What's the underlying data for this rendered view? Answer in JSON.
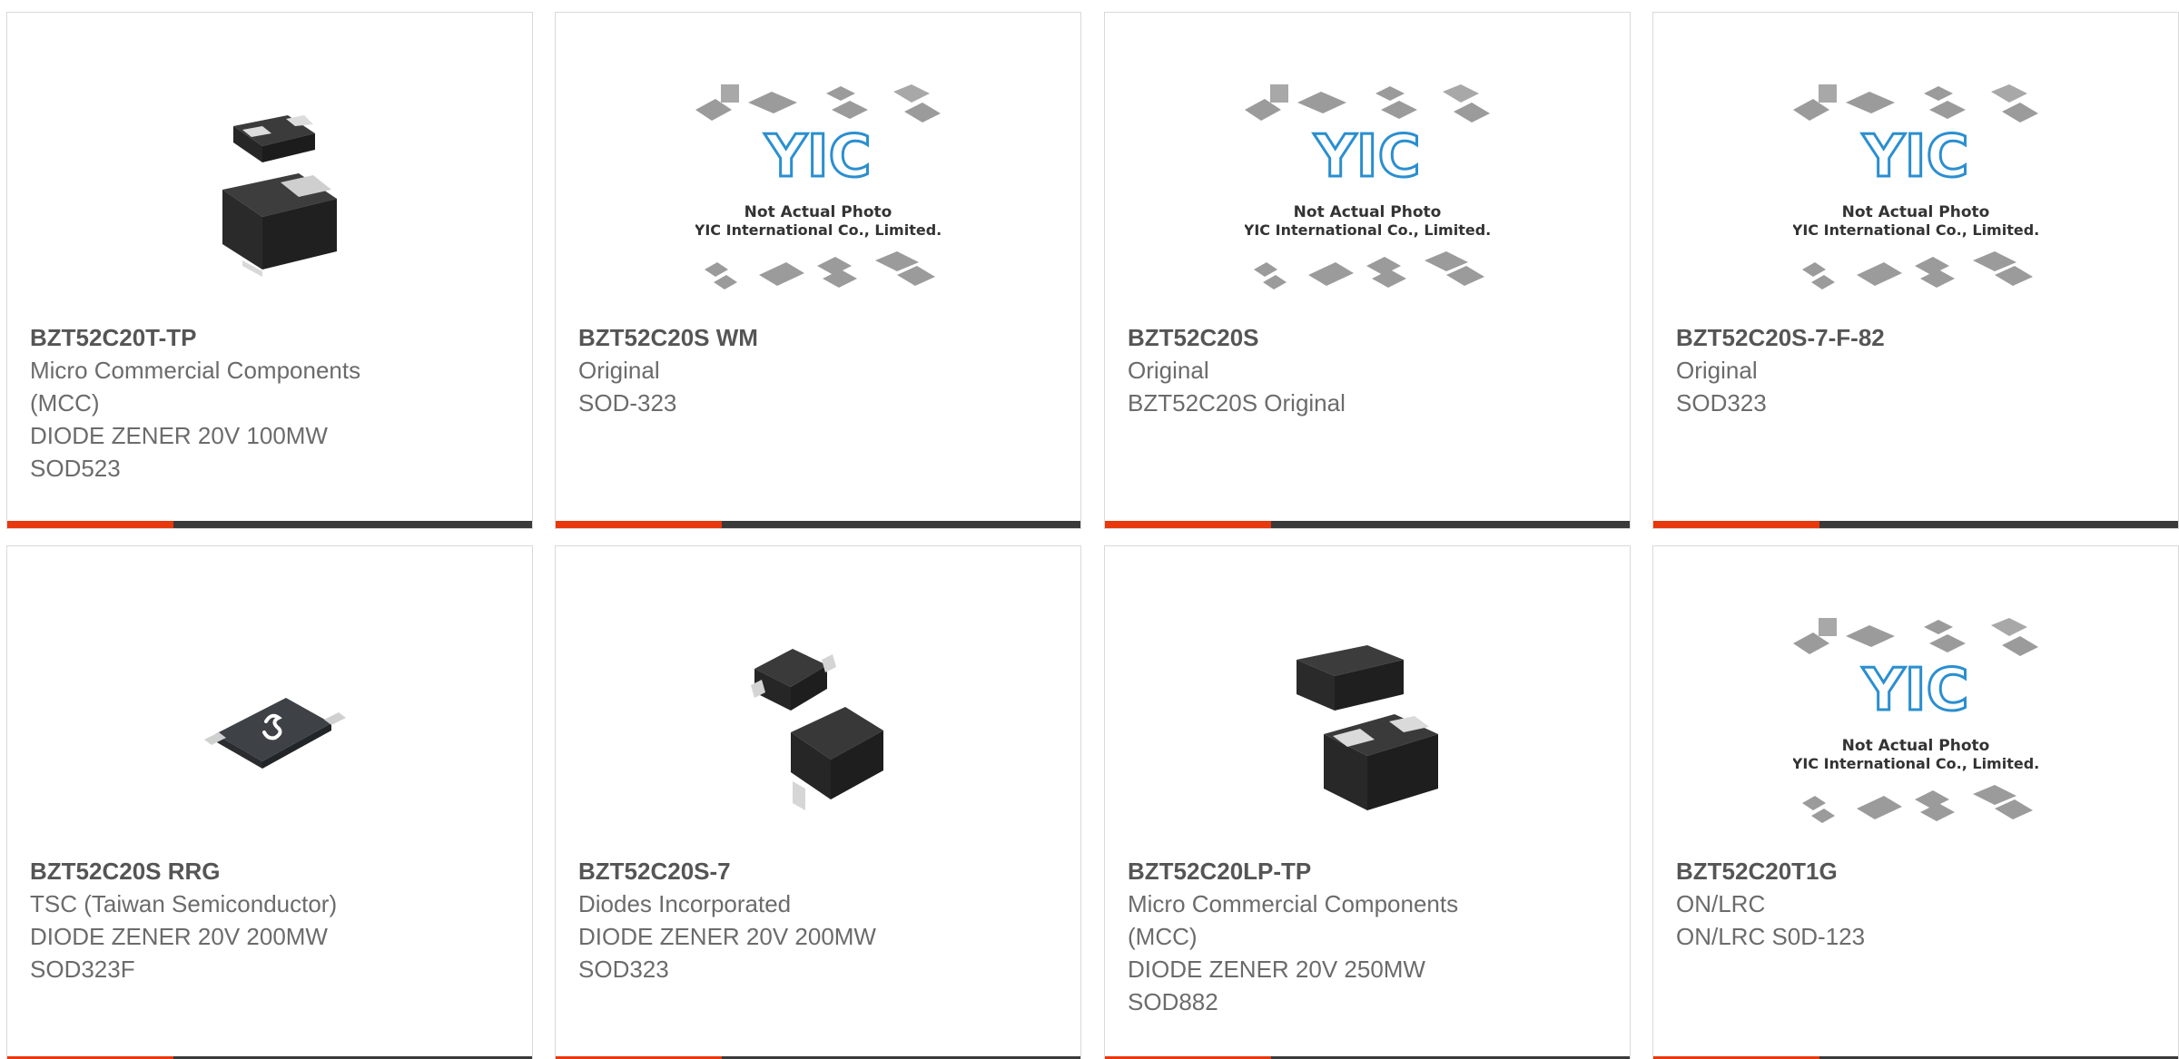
{
  "colors": {
    "accent_bar": "#e8380d",
    "dark_bar": "#3a3a3a",
    "part_number_text": "#555555",
    "detail_text": "#6b6b6b"
  },
  "placeholder_image": {
    "line1": "Not Actual Photo",
    "line2": "YIC International Co., Limited.",
    "logo": "YIC"
  },
  "products": [
    {
      "part_number": "BZT52C20T-TP",
      "lines": [
        "Micro Commercial Components",
        "(MCC)",
        "DIODE ZENER 20V 100MW",
        "SOD523"
      ],
      "image": "sod523-package-icon"
    },
    {
      "part_number": "BZT52C20S WM",
      "lines": [
        "Original",
        "SOD-323"
      ],
      "image": "yic-placeholder"
    },
    {
      "part_number": "BZT52C20S",
      "lines": [
        "Original",
        "BZT52C20S Original"
      ],
      "image": "yic-placeholder"
    },
    {
      "part_number": "BZT52C20S-7-F-82",
      "lines": [
        "Original",
        "SOD323"
      ],
      "image": "yic-placeholder"
    },
    {
      "part_number": "BZT52C20S RRG",
      "lines": [
        "TSC (Taiwan Semiconductor)",
        "DIODE ZENER 20V 200MW",
        "SOD323F"
      ],
      "image": "sod323f-package-icon"
    },
    {
      "part_number": "BZT52C20S-7",
      "lines": [
        "Diodes Incorporated",
        "DIODE ZENER 20V 200MW",
        "SOD323"
      ],
      "image": "sod323-package-icon"
    },
    {
      "part_number": "BZT52C20LP-TP",
      "lines": [
        "Micro Commercial Components",
        "(MCC)",
        "DIODE ZENER 20V 250MW",
        "SOD882"
      ],
      "image": "sod882-package-icon"
    },
    {
      "part_number": "BZT52C20T1G",
      "lines": [
        "ON/LRC",
        "ON/LRC S0D-123"
      ],
      "image": "yic-placeholder"
    }
  ]
}
